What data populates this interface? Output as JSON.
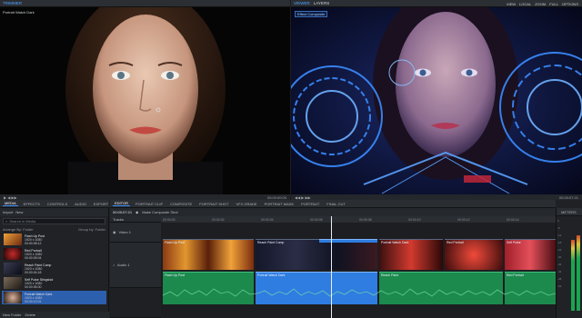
{
  "viewers": {
    "trimmer_tab": "TRIMMER",
    "trimmer_clip": "Portrait Watch Dark",
    "viewer_tabs": [
      "VIEWER",
      "LAYERS"
    ],
    "vfx_label": "Effect Composite",
    "top_menu": [
      "VIEW",
      "LOCAL",
      "ZOOM",
      "FULL",
      "OPTIONS"
    ],
    "trimmer_timecode": "00:00:00:00",
    "viewer_timecode": "00:00:07:21"
  },
  "lower_tabs": [
    "MEDIA",
    "EFFECTS",
    "CONTROLS",
    "AUDIO",
    "EXPORT",
    "EDITOR",
    "PORTRAIT CLIP",
    "COMPOSITE",
    "PORTRAIT SHOT",
    "VFX GRADE",
    "PORTRAIT MASK",
    "PORTRAIT",
    "FINAL CUT"
  ],
  "media": {
    "tools": [
      "Import",
      "New"
    ],
    "search_placeholder": "Search in Media",
    "arrange_label": "Arrange By: Folder",
    "group_label": "Group by: Folder",
    "items": [
      {
        "name": "Flash Up Post",
        "line2": "1920 x 1080",
        "line3": "00:00:08:12"
      },
      {
        "name": "Red Portrait",
        "line2": "1920 x 1080",
        "line3": "00:00:05:04"
      },
      {
        "name": "Reach Paint Comp",
        "line2": "1920 x 1080",
        "line3": "00:00:04:18"
      },
      {
        "name": "Self Pulse Stingshot",
        "line2": "1920 x 1080",
        "line3": "00:00:06:00"
      },
      {
        "name": "Portrait Watch Dark",
        "line2": "1920 x 1080",
        "line3": "00:00:10:01"
      }
    ],
    "bottom": [
      "New Folder",
      "Delete"
    ]
  },
  "timeline": {
    "timecode": "00:00:07:21",
    "composite_label": "Make Composite Shot",
    "ruler_ticks": [
      "00:00:00",
      "00:00:02",
      "00:00:04",
      "00:00:06",
      "00:00:08",
      "00:00:10",
      "00:00:12",
      "00:00:14"
    ],
    "tracks": [
      "Tracks",
      "Video 1",
      "Audio 1"
    ],
    "video_clips": [
      "Flash Up Post",
      "Reach Paint Comp",
      "Portrait Watch Dark",
      "Red Portrait",
      "Self Pulse"
    ],
    "audio_clips": [
      "Flash Up Post",
      "Portrait Watch Dark",
      "Reach Paint",
      "Red Portrait"
    ]
  },
  "meters": {
    "label": "METERS",
    "scale": [
      "0",
      "-6",
      "-12",
      "-18",
      "-24",
      "-30",
      "-36",
      "-42",
      "-48",
      "-54"
    ],
    "levels": [
      0.78,
      0.83
    ]
  },
  "colors": {
    "accent": "#2f7de0",
    "audio": "#1c8a4d",
    "hud": "#3b8cff"
  }
}
